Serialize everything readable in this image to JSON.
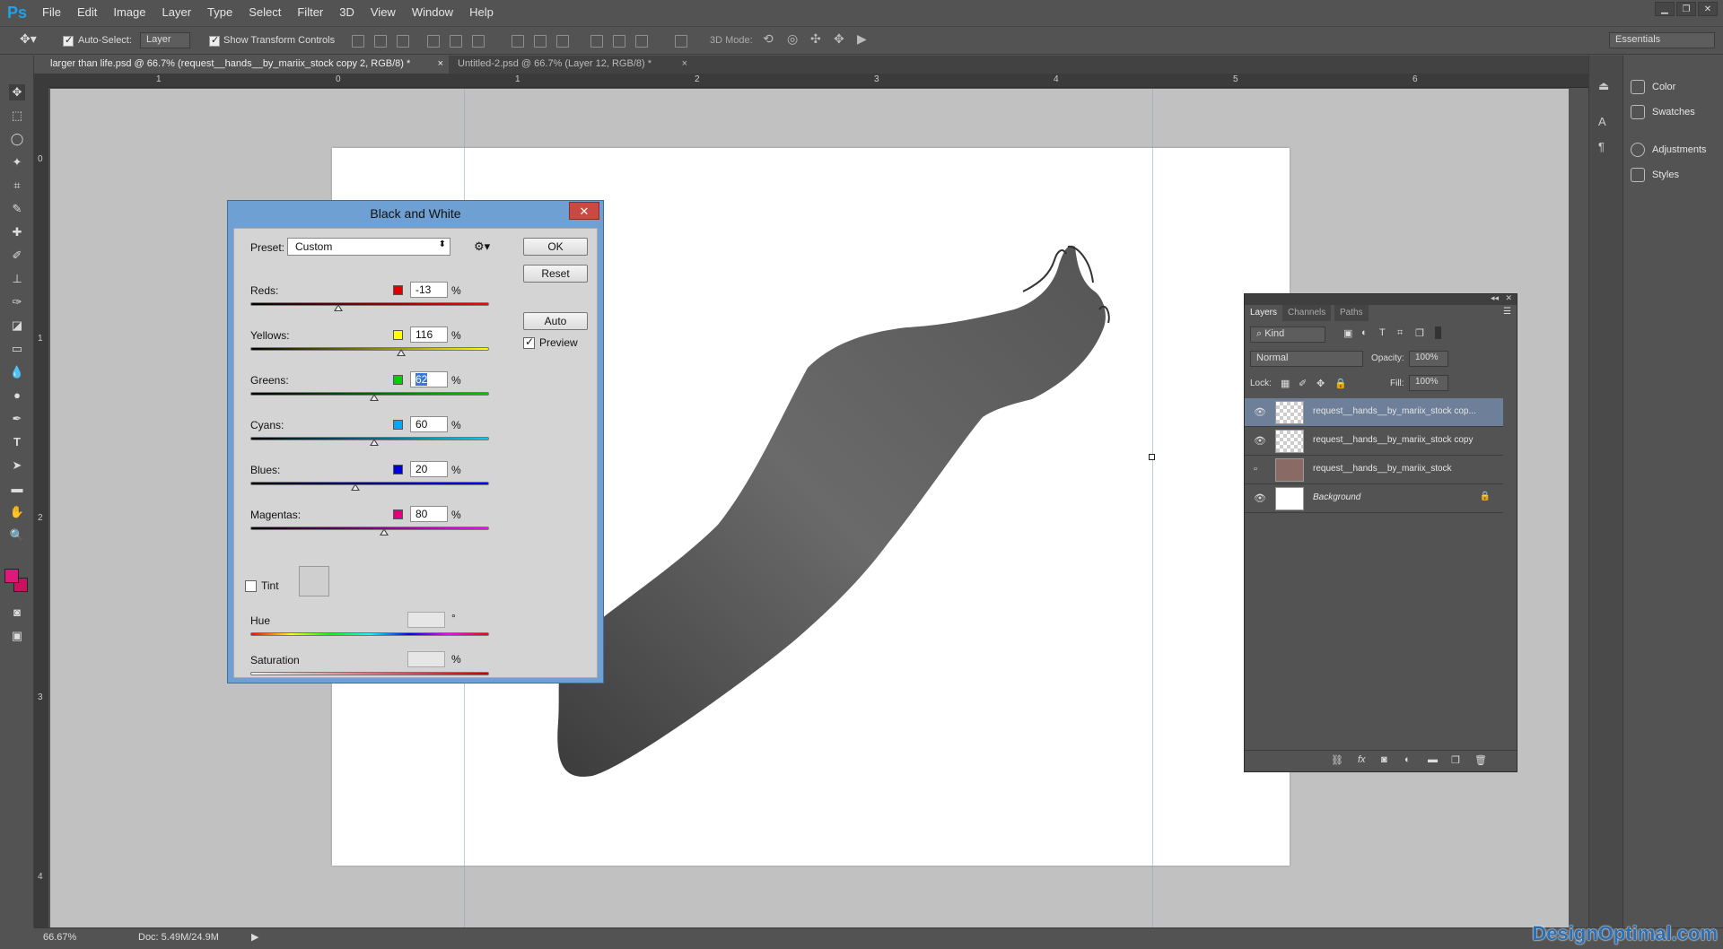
{
  "app": {
    "logo": "Ps"
  },
  "menu": [
    "File",
    "Edit",
    "Image",
    "Layer",
    "Type",
    "Select",
    "Filter",
    "3D",
    "View",
    "Window",
    "Help"
  ],
  "options": {
    "auto_select_label": "Auto-Select:",
    "auto_select_value": "Layer",
    "transform_label": "Show Transform Controls",
    "mode_label": "3D Mode:",
    "workspace": "Essentials"
  },
  "tabs": [
    {
      "label": "larger than life.psd @ 66.7% (request__hands__by_mariix_stock copy 2, RGB/8) *",
      "close": "×"
    },
    {
      "label": "Untitled-2.psd @ 66.7% (Layer 12, RGB/8) *",
      "close": "×"
    }
  ],
  "ruler": {
    "top": [
      "1",
      "0",
      "1",
      "2",
      "3",
      "4",
      "5",
      "6"
    ],
    "left": [
      "0",
      "1",
      "2",
      "3",
      "4"
    ]
  },
  "right_panel": {
    "items": [
      "Color",
      "Swatches",
      "Adjustments",
      "Styles"
    ]
  },
  "status": {
    "zoom": "66.67%",
    "doc": "Doc: 5.49M/24.9M"
  },
  "dialog": {
    "title": "Black and White",
    "close": "✕",
    "preset_label": "Preset:",
    "preset_value": "Custom",
    "ok": "OK",
    "reset": "Reset",
    "auto": "Auto",
    "preview_label": "Preview",
    "sliders": [
      {
        "label": "Reds:",
        "value": "-13",
        "unit": "%",
        "color": "#e00000",
        "pos": 0.37,
        "grad": "linear-gradient(90deg,#000,#f00)"
      },
      {
        "label": "Yellows:",
        "value": "116",
        "unit": "%",
        "color": "#ffff00",
        "pos": 0.63,
        "grad": "linear-gradient(90deg,#000,#ff0)"
      },
      {
        "label": "Greens:",
        "value": "62",
        "unit": "%",
        "color": "#00d000",
        "pos": 0.52,
        "grad": "linear-gradient(90deg,#000,#0c0)"
      },
      {
        "label": "Cyans:",
        "value": "60",
        "unit": "%",
        "color": "#00aaee",
        "pos": 0.52,
        "grad": "linear-gradient(90deg,#000,#0cf)"
      },
      {
        "label": "Blues:",
        "value": "20",
        "unit": "%",
        "color": "#0000dd",
        "pos": 0.44,
        "grad": "linear-gradient(90deg,#000,#00f)"
      },
      {
        "label": "Magentas:",
        "value": "80",
        "unit": "%",
        "color": "#e0007a",
        "pos": 0.56,
        "grad": "linear-gradient(90deg,#000,#f0f)"
      }
    ],
    "tint_label": "Tint",
    "hue_label": "Hue",
    "hue_unit": "°",
    "sat_label": "Saturation",
    "sat_unit": "%"
  },
  "layers": {
    "tabs": [
      "Layers",
      "Channels",
      "Paths"
    ],
    "filter": "Kind",
    "blend": "Normal",
    "opacity_label": "Opacity:",
    "opacity": "100%",
    "lock_label": "Lock:",
    "fill_label": "Fill:",
    "fill": "100%",
    "rows": [
      {
        "name": "request__hands__by_mariix_stock cop...",
        "visible": true,
        "selected": true
      },
      {
        "name": "request__hands__by_mariix_stock copy",
        "visible": true,
        "selected": false
      },
      {
        "name": "request__hands__by_mariix_stock",
        "visible": false,
        "selected": false
      },
      {
        "name": "Background",
        "visible": true,
        "selected": false
      }
    ]
  },
  "watermark": "DesignOptimal.com"
}
